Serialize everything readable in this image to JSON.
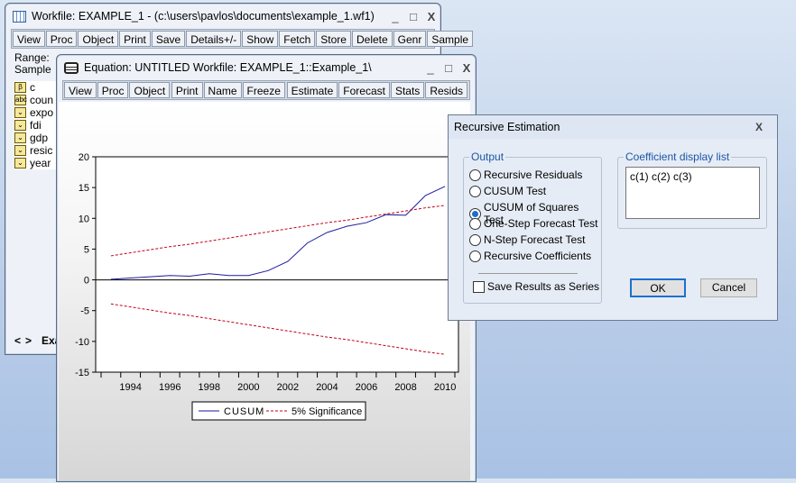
{
  "workfile": {
    "title": "Workfile: EXAMPLE_1 - (c:\\users\\pavlos\\documents\\example_1.wf1)",
    "toolbar": [
      "View",
      "Proc",
      "Object",
      "|",
      "Print",
      "Save",
      "Details+/-",
      "|",
      "Show",
      "Fetch",
      "Store",
      "Delete",
      "Genr",
      "Sample"
    ],
    "range_label": "Range:",
    "sample_label": "Sample",
    "objects": [
      {
        "icon": "beta-icon",
        "glyph": "β",
        "name": "c"
      },
      {
        "icon": "alpha-series-icon",
        "glyph": "abc",
        "name": "coun"
      },
      {
        "icon": "series-icon",
        "glyph": "⌄",
        "name": "expo"
      },
      {
        "icon": "series-icon",
        "glyph": "⌄",
        "name": "fdi"
      },
      {
        "icon": "series-icon",
        "glyph": "⌄",
        "name": "gdp"
      },
      {
        "icon": "series-icon",
        "glyph": "⌄",
        "name": "resic"
      },
      {
        "icon": "series-icon",
        "glyph": "⌄",
        "name": "year"
      }
    ],
    "tab": "Exa",
    "nav_prev": "<",
    "nav_next": ">"
  },
  "equation": {
    "title": "Equation: UNTITLED   Workfile: EXAMPLE_1::Example_1\\",
    "toolbar": [
      "View",
      "Proc",
      "Object",
      "|",
      "Print",
      "Name",
      "Freeze",
      "|",
      "Estimate",
      "Forecast",
      "Stats",
      "Resids"
    ]
  },
  "window_controls": {
    "minimize": "_",
    "maximize": "□",
    "close": "X"
  },
  "chart_data": {
    "type": "line",
    "x": [
      1993,
      1994,
      1995,
      1996,
      1997,
      1998,
      1999,
      2000,
      2001,
      2002,
      2003,
      2004,
      2005,
      2006,
      2007,
      2008,
      2009,
      2010
    ],
    "xticks": [
      "1994",
      "1996",
      "1998",
      "2000",
      "2002",
      "2004",
      "2006",
      "2008",
      "2010"
    ],
    "yticks": [
      "20",
      "15",
      "10",
      "5",
      "0",
      "-5",
      "-10",
      "-15"
    ],
    "ylim": [
      -15,
      20
    ],
    "xlim": [
      1992.5,
      2010.5
    ],
    "series": [
      {
        "name": "CUSUM",
        "color": "#1a1aa0",
        "style": "solid",
        "values": [
          0.1,
          0.3,
          0.5,
          0.7,
          0.6,
          1.0,
          0.7,
          0.7,
          1.5,
          3.0,
          6.0,
          7.7,
          8.7,
          9.3,
          10.6,
          10.5,
          13.7,
          15.2
        ]
      },
      {
        "name": "5% Significance",
        "color": "#c0001a",
        "style": "dashed",
        "values": [
          3.9,
          4.4,
          4.9,
          5.4,
          5.8,
          6.3,
          6.8,
          7.3,
          7.8,
          8.3,
          8.8,
          9.3,
          9.7,
          10.2,
          10.7,
          11.2,
          11.7,
          12.1
        ]
      },
      {
        "name": "",
        "color": "#c0001a",
        "style": "dashed",
        "values": [
          -3.9,
          -4.4,
          -4.9,
          -5.4,
          -5.8,
          -6.3,
          -6.8,
          -7.3,
          -7.8,
          -8.3,
          -8.8,
          -9.3,
          -9.7,
          -10.2,
          -10.7,
          -11.2,
          -11.7,
          -12.1
        ]
      }
    ],
    "legend": [
      "CUSUM",
      "5% Significance"
    ],
    "legend_position": "bottom"
  },
  "dialog": {
    "title": "Recursive Estimation",
    "close": "X",
    "output_label": "Output",
    "options": [
      {
        "label": "Recursive Residuals",
        "selected": false
      },
      {
        "label": "CUSUM Test",
        "selected": false
      },
      {
        "label": "CUSUM of Squares Test",
        "selected": true
      },
      {
        "label": "One-Step Forecast Test",
        "selected": false
      },
      {
        "label": "N-Step Forecast Test",
        "selected": false
      },
      {
        "label": "Recursive Coefficients",
        "selected": false
      }
    ],
    "save_label": "Save Results as Series",
    "save_checked": false,
    "coef_label": "Coefficient display list",
    "coef_value": "c(1) c(2) c(3)",
    "ok": "OK",
    "cancel": "Cancel"
  }
}
